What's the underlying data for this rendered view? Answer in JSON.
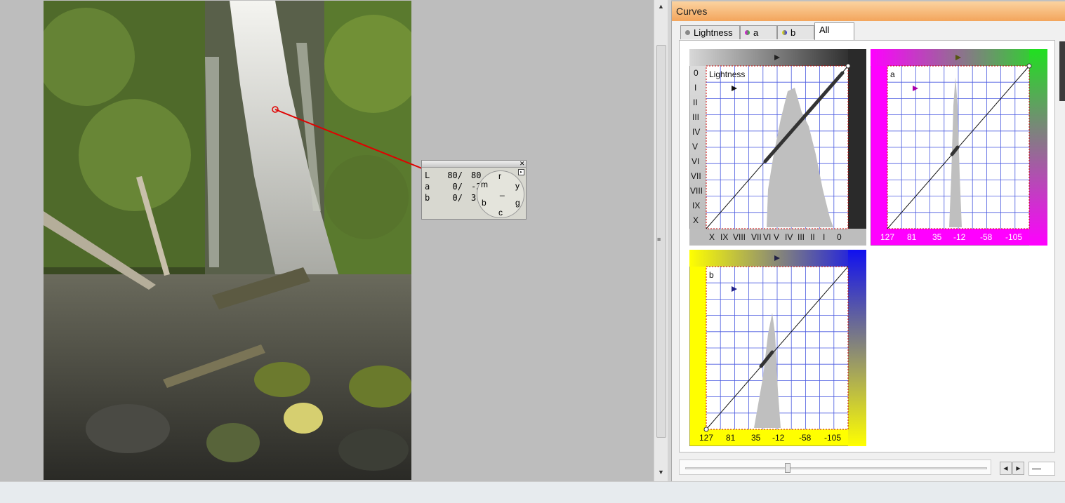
{
  "panel": {
    "title": "Curves",
    "tabs": [
      {
        "label": "Lightness",
        "icon": "gray-dot-icon"
      },
      {
        "label": "a",
        "icon": "magenta-green-dot-icon"
      },
      {
        "label": "b",
        "icon": "yellow-blue-dot-icon"
      },
      {
        "label": "All",
        "active": true
      }
    ],
    "zoom_value": "—"
  },
  "probe": {
    "rows": [
      {
        "ch": "L",
        "before": "80/",
        "after": "80"
      },
      {
        "ch": "a",
        "before": "0/",
        "after": "-2"
      },
      {
        "ch": "b",
        "before": "0/",
        "after": "3"
      }
    ],
    "dial": {
      "top": "r",
      "left": "m",
      "right": "y",
      "bottom_left": "b",
      "bottom_right": "g",
      "bottom": "c",
      "center": "_"
    }
  },
  "curves": {
    "lightness": {
      "label": "Lightness",
      "left_zones": [
        "0",
        "I",
        "II",
        "III",
        "IV",
        "V",
        "VI",
        "VII",
        "VIII",
        "IX",
        "X"
      ],
      "bottom_zones": [
        "X",
        "IX",
        "VIII",
        "VII",
        "VI",
        "V",
        "IV",
        "III",
        "II",
        "I",
        "0"
      ],
      "colors": {
        "frame_top": "#3a3a3a",
        "frame_light": "#d8d8d8"
      }
    },
    "a": {
      "label": "a",
      "ticks": [
        "127",
        "81",
        "35",
        "-12",
        "-58",
        "-105"
      ],
      "colors": {
        "left": "#ff00ff",
        "right": "#20e020"
      }
    },
    "b": {
      "label": "b",
      "ticks": [
        "127",
        "81",
        "35",
        "-12",
        "-58",
        "-105"
      ],
      "colors": {
        "left": "#ffff00",
        "right": "#1010f0"
      }
    },
    "grid_color": "#4a5ae0"
  },
  "colors": {
    "probe_line": "#e00000",
    "title_bar": "#f3a55c"
  }
}
